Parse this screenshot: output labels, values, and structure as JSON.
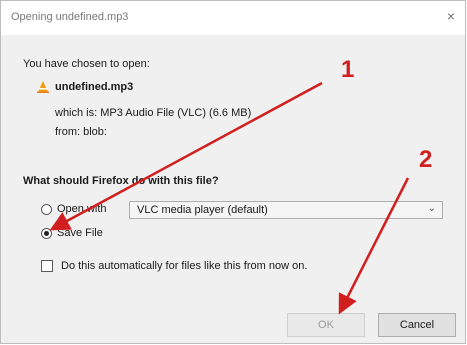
{
  "dialog": {
    "title": "Opening undefined.mp3",
    "close_glyph": "×"
  },
  "content": {
    "intro": "You have chosen to open:",
    "filename": "undefined.mp3",
    "which_is": "which is: MP3 Audio File (VLC) (6.6 MB)",
    "from": "from: blob:",
    "question": "What should Firefox do with this file?",
    "open_with_label": "Open with",
    "open_with_app": "VLC media player (default)",
    "save_file_label": "Save File",
    "auto_label": "Do this automatically for files like this from now on."
  },
  "buttons": {
    "ok": "OK",
    "cancel": "Cancel"
  },
  "annotations": {
    "marker_1": "1",
    "marker_2": "2",
    "arrow_color": "#d11f1f"
  },
  "icons": {
    "file_icon": "vlc-cone-icon",
    "dropdown": "chevron-down-icon"
  }
}
